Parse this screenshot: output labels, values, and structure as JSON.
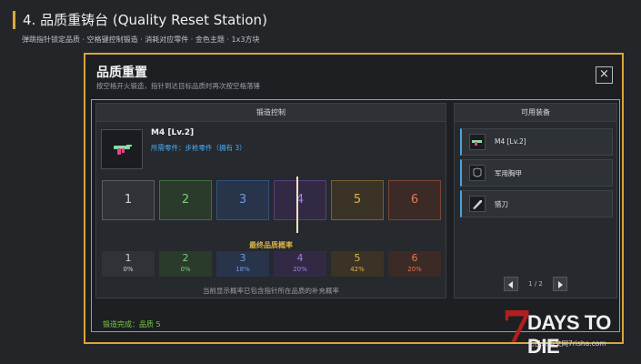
{
  "header": {
    "title": "4. 品质重铸台 (Quality Reset Station)",
    "subtitle": "弹跳指针锁定品质 · 空格键控制锻造 · 消耗对应零件 · 金色主题 · 1x3方块"
  },
  "modal": {
    "title": "品质重置",
    "subtitle": "按空格开火锻造，指针到达目标品质时再次按空格落锤",
    "close_label": "×"
  },
  "forge": {
    "header": "锻造控制",
    "item_name": "M4 [Lv.2]",
    "requirement": "所需零件：步枪零件（拥有 3）",
    "tiers": [
      {
        "label": "1",
        "border": "#5a5e63",
        "bg": "#2f3337",
        "color": "#cfd2d5"
      },
      {
        "label": "2",
        "border": "#3f6e40",
        "bg": "#2a3a2b",
        "color": "#7cd07a"
      },
      {
        "label": "3",
        "border": "#34517d",
        "bg": "#27344a",
        "color": "#6f9be0"
      },
      {
        "label": "4",
        "border": "#5a3f7d",
        "bg": "#322a45",
        "color": "#a27fde"
      },
      {
        "label": "5",
        "border": "#7a6131",
        "bg": "#3a3326",
        "color": "#e0b34b"
      },
      {
        "label": "6",
        "border": "#7d4533",
        "bg": "#3b2a25",
        "color": "#e27a55"
      }
    ],
    "marker_value": 4,
    "prob_label": "最终品质概率",
    "probabilities": [
      {
        "tier": "1",
        "pct": "0%",
        "color": "#cfd2d5"
      },
      {
        "tier": "2",
        "pct": "0%",
        "color": "#7cd07a"
      },
      {
        "tier": "3",
        "pct": "18%",
        "color": "#6f9be0"
      },
      {
        "tier": "4",
        "pct": "20%",
        "color": "#a27fde"
      },
      {
        "tier": "5",
        "pct": "42%",
        "color": "#e0b34b"
      },
      {
        "tier": "6",
        "pct": "20%",
        "color": "#e27a55"
      }
    ],
    "note": "当前显示概率已包含指针所在品质的补充概率"
  },
  "equipment": {
    "header": "可用装备",
    "items": [
      {
        "name": "M4 [Lv.2]",
        "icon": "rifle-icon"
      },
      {
        "name": "军用胸甲",
        "icon": "armor-icon"
      },
      {
        "name": "猎刀",
        "icon": "knife-icon"
      }
    ],
    "page": "1 / 2"
  },
  "status": "锻造完成：品质 5",
  "watermark": {
    "seven": "7",
    "logo": "DAYS TO DIE",
    "site": "七日杀中文网7risha.com"
  }
}
